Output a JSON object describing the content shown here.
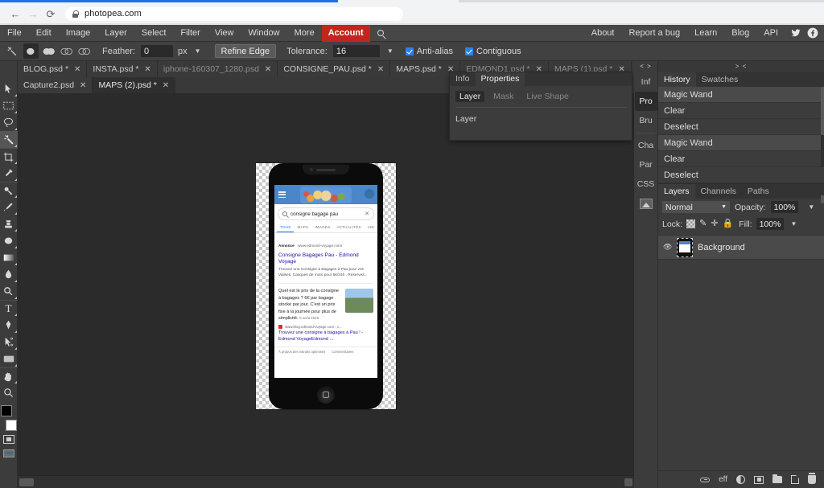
{
  "browser": {
    "url": "photopea.com",
    "back_icon": "back-arrow-icon",
    "forward_icon": "forward-arrow-icon",
    "reload_icon": "reload-icon",
    "lock_icon": "lock-icon"
  },
  "menubar": {
    "items": [
      "File",
      "Edit",
      "Image",
      "Layer",
      "Select",
      "Filter",
      "View",
      "Window",
      "More"
    ],
    "account_label": "Account",
    "search_icon": "search-icon",
    "right_items": [
      "About",
      "Report a bug",
      "Learn",
      "Blog",
      "API"
    ],
    "twitter_icon": "twitter-icon",
    "facebook_icon": "facebook-icon"
  },
  "options_bar": {
    "tool_icon": "magic-wand-icon",
    "selection_modes": [
      "new-selection",
      "add-to-selection",
      "subtract-from-selection",
      "intersect-selection"
    ],
    "feather_label": "Feather:",
    "feather_value": "0",
    "feather_unit": "px",
    "refine_edge_label": "Refine Edge",
    "tolerance_label": "Tolerance:",
    "tolerance_value": "16",
    "antialias_label": "Anti-alias",
    "contiguous_label": "Contiguous",
    "antialias_checked": true,
    "contiguous_checked": true
  },
  "document_tabs": {
    "row1": [
      {
        "name": "BLOG.psd *",
        "active": false
      },
      {
        "name": "INSTA.psd *",
        "active": false
      },
      {
        "name": "iphone-160307_1280.psd",
        "active": false
      },
      {
        "name": "CONSIGNE_PAU.psd *",
        "active": false
      },
      {
        "name": "MAPS.psd *",
        "active": false
      },
      {
        "name": "EDMOND1.psd *",
        "active": false
      },
      {
        "name": "MAPS (1).psd *",
        "active": false
      }
    ],
    "row2": [
      {
        "name": "Capture2.psd",
        "active": false
      },
      {
        "name": "MAPS (2).psd *",
        "active": true
      }
    ],
    "close_glyph": "✕"
  },
  "toolbar": {
    "tools": [
      {
        "name": "move-tool",
        "glyph": "➚"
      },
      {
        "name": "marquee-tool",
        "glyph": "▭"
      },
      {
        "name": "lasso-tool",
        "glyph": "◯"
      },
      {
        "name": "magic-wand-tool",
        "glyph": "✦"
      },
      {
        "name": "crop-tool",
        "glyph": "⌗"
      },
      {
        "name": "eyedropper-tool",
        "glyph": "✐"
      },
      {
        "name": "healing-brush-tool",
        "glyph": "✚"
      },
      {
        "name": "brush-tool",
        "glyph": "✎"
      },
      {
        "name": "clone-stamp-tool",
        "glyph": "⊥"
      },
      {
        "name": "eraser-tool",
        "glyph": "◓"
      },
      {
        "name": "gradient-tool",
        "glyph": "▤"
      },
      {
        "name": "blur-tool",
        "glyph": "💧"
      },
      {
        "name": "dodge-tool",
        "glyph": "⚲"
      },
      {
        "name": "type-tool",
        "glyph": "T"
      },
      {
        "name": "pen-tool",
        "glyph": "✒"
      },
      {
        "name": "path-select-tool",
        "glyph": "↖"
      },
      {
        "name": "shape-tool",
        "glyph": "▬"
      },
      {
        "name": "hand-tool",
        "glyph": "✋"
      },
      {
        "name": "zoom-tool",
        "glyph": "🔍"
      }
    ],
    "active_tool": "magic-wand-tool",
    "foreground_color": "#000000",
    "background_color": "#ffffff"
  },
  "float_panel": {
    "tabs": [
      {
        "label": "Info",
        "active": false
      },
      {
        "label": "Properties",
        "active": true
      }
    ],
    "subtabs": [
      {
        "label": "Layer",
        "active": true
      },
      {
        "label": "Mask",
        "active": false
      },
      {
        "label": "Live Shape",
        "active": false
      }
    ],
    "body_text": "Layer"
  },
  "rail": {
    "top_glyph": "< >",
    "items": [
      {
        "label": "Inf",
        "active": false
      },
      {
        "label": "Pro",
        "active": true
      },
      {
        "label": "Bru",
        "active": false
      },
      {
        "label": "Cha",
        "active": false
      },
      {
        "label": "Par",
        "active": false
      },
      {
        "label": "CSS",
        "active": false
      }
    ],
    "image_icon": "image-icon"
  },
  "history_panel": {
    "grip_glyph": "> <",
    "tabs": [
      {
        "label": "History",
        "active": true
      },
      {
        "label": "Swatches",
        "active": false
      }
    ],
    "items": [
      {
        "label": "Magic Wand",
        "selected": true
      },
      {
        "label": "Clear",
        "selected": false
      },
      {
        "label": "Deselect",
        "selected": false
      },
      {
        "label": "Magic Wand",
        "selected": true
      },
      {
        "label": "Clear",
        "selected": false
      },
      {
        "label": "Deselect",
        "selected": false
      }
    ]
  },
  "layers_panel": {
    "tabs": [
      {
        "label": "Layers",
        "active": true
      },
      {
        "label": "Channels",
        "active": false
      },
      {
        "label": "Paths",
        "active": false
      }
    ],
    "blend_mode": "Normal",
    "blend_caret": "▼",
    "opacity_label": "Opacity:",
    "opacity_value": "100%",
    "lock_label": "Lock:",
    "fill_label": "Fill:",
    "fill_value": "100%",
    "lock_icons": [
      "lock-transparency-icon",
      "lock-paint-icon",
      "lock-move-icon",
      "lock-all-icon"
    ],
    "layers": [
      {
        "name": "Background",
        "visible": true,
        "selected": true
      }
    ],
    "bottom_icons": [
      {
        "name": "link-layers-icon",
        "label": ""
      },
      {
        "name": "layer-effects-icon",
        "label": "eff"
      },
      {
        "name": "adjustment-layer-icon",
        "label": ""
      },
      {
        "name": "layer-mask-icon",
        "label": ""
      },
      {
        "name": "new-group-icon",
        "label": ""
      },
      {
        "name": "new-layer-icon",
        "label": ""
      },
      {
        "name": "delete-layer-icon",
        "label": ""
      }
    ]
  },
  "canvas": {
    "document_name": "MAPS (2).psd",
    "phone_mockup": {
      "home_button_icon": "home-button-icon",
      "screen": {
        "header": {
          "menu_icon": "hamburger-menu-icon",
          "doodle_icon": "google-doodle-icon",
          "avatar_icon": "account-avatar-icon"
        },
        "search": {
          "query": "consigne bagage pau",
          "search_icon": "search-icon",
          "clear_icon": "clear-icon"
        },
        "tabs": [
          {
            "label": "TOUS",
            "active": true
          },
          {
            "label": "MAPS",
            "active": false
          },
          {
            "label": "IMAGES",
            "active": false
          },
          {
            "label": "ACTUALITÉS",
            "active": false
          },
          {
            "label": "VID",
            "active": false
          }
        ],
        "ad_result": {
          "badge": "Annonce",
          "url": "www.edmond-voyage.com/",
          "title": "Consigne Bagages Pau - Edmond Voyage",
          "description": "Trouvez une Consigne à Bagages à Pau pour vos Valises, Casques de moto pour 6€/24h . Réservez..."
        },
        "featured_snippet": {
          "text": "Quel est le prix de la consigne à bagages ? 6€ par bagage stocké par jour. C'est un prix fixe à la journée pour plus de simplicité.",
          "date": "9 août 2019",
          "source_url": "www.blog.edmond-voyage.com › c...",
          "link": "Trouvez une consigne à bagages à Pau ! - Edmond VoyageEdmond ...",
          "footer": [
            "À propos des extraits optimisés",
            "Commentaires"
          ]
        }
      }
    }
  }
}
